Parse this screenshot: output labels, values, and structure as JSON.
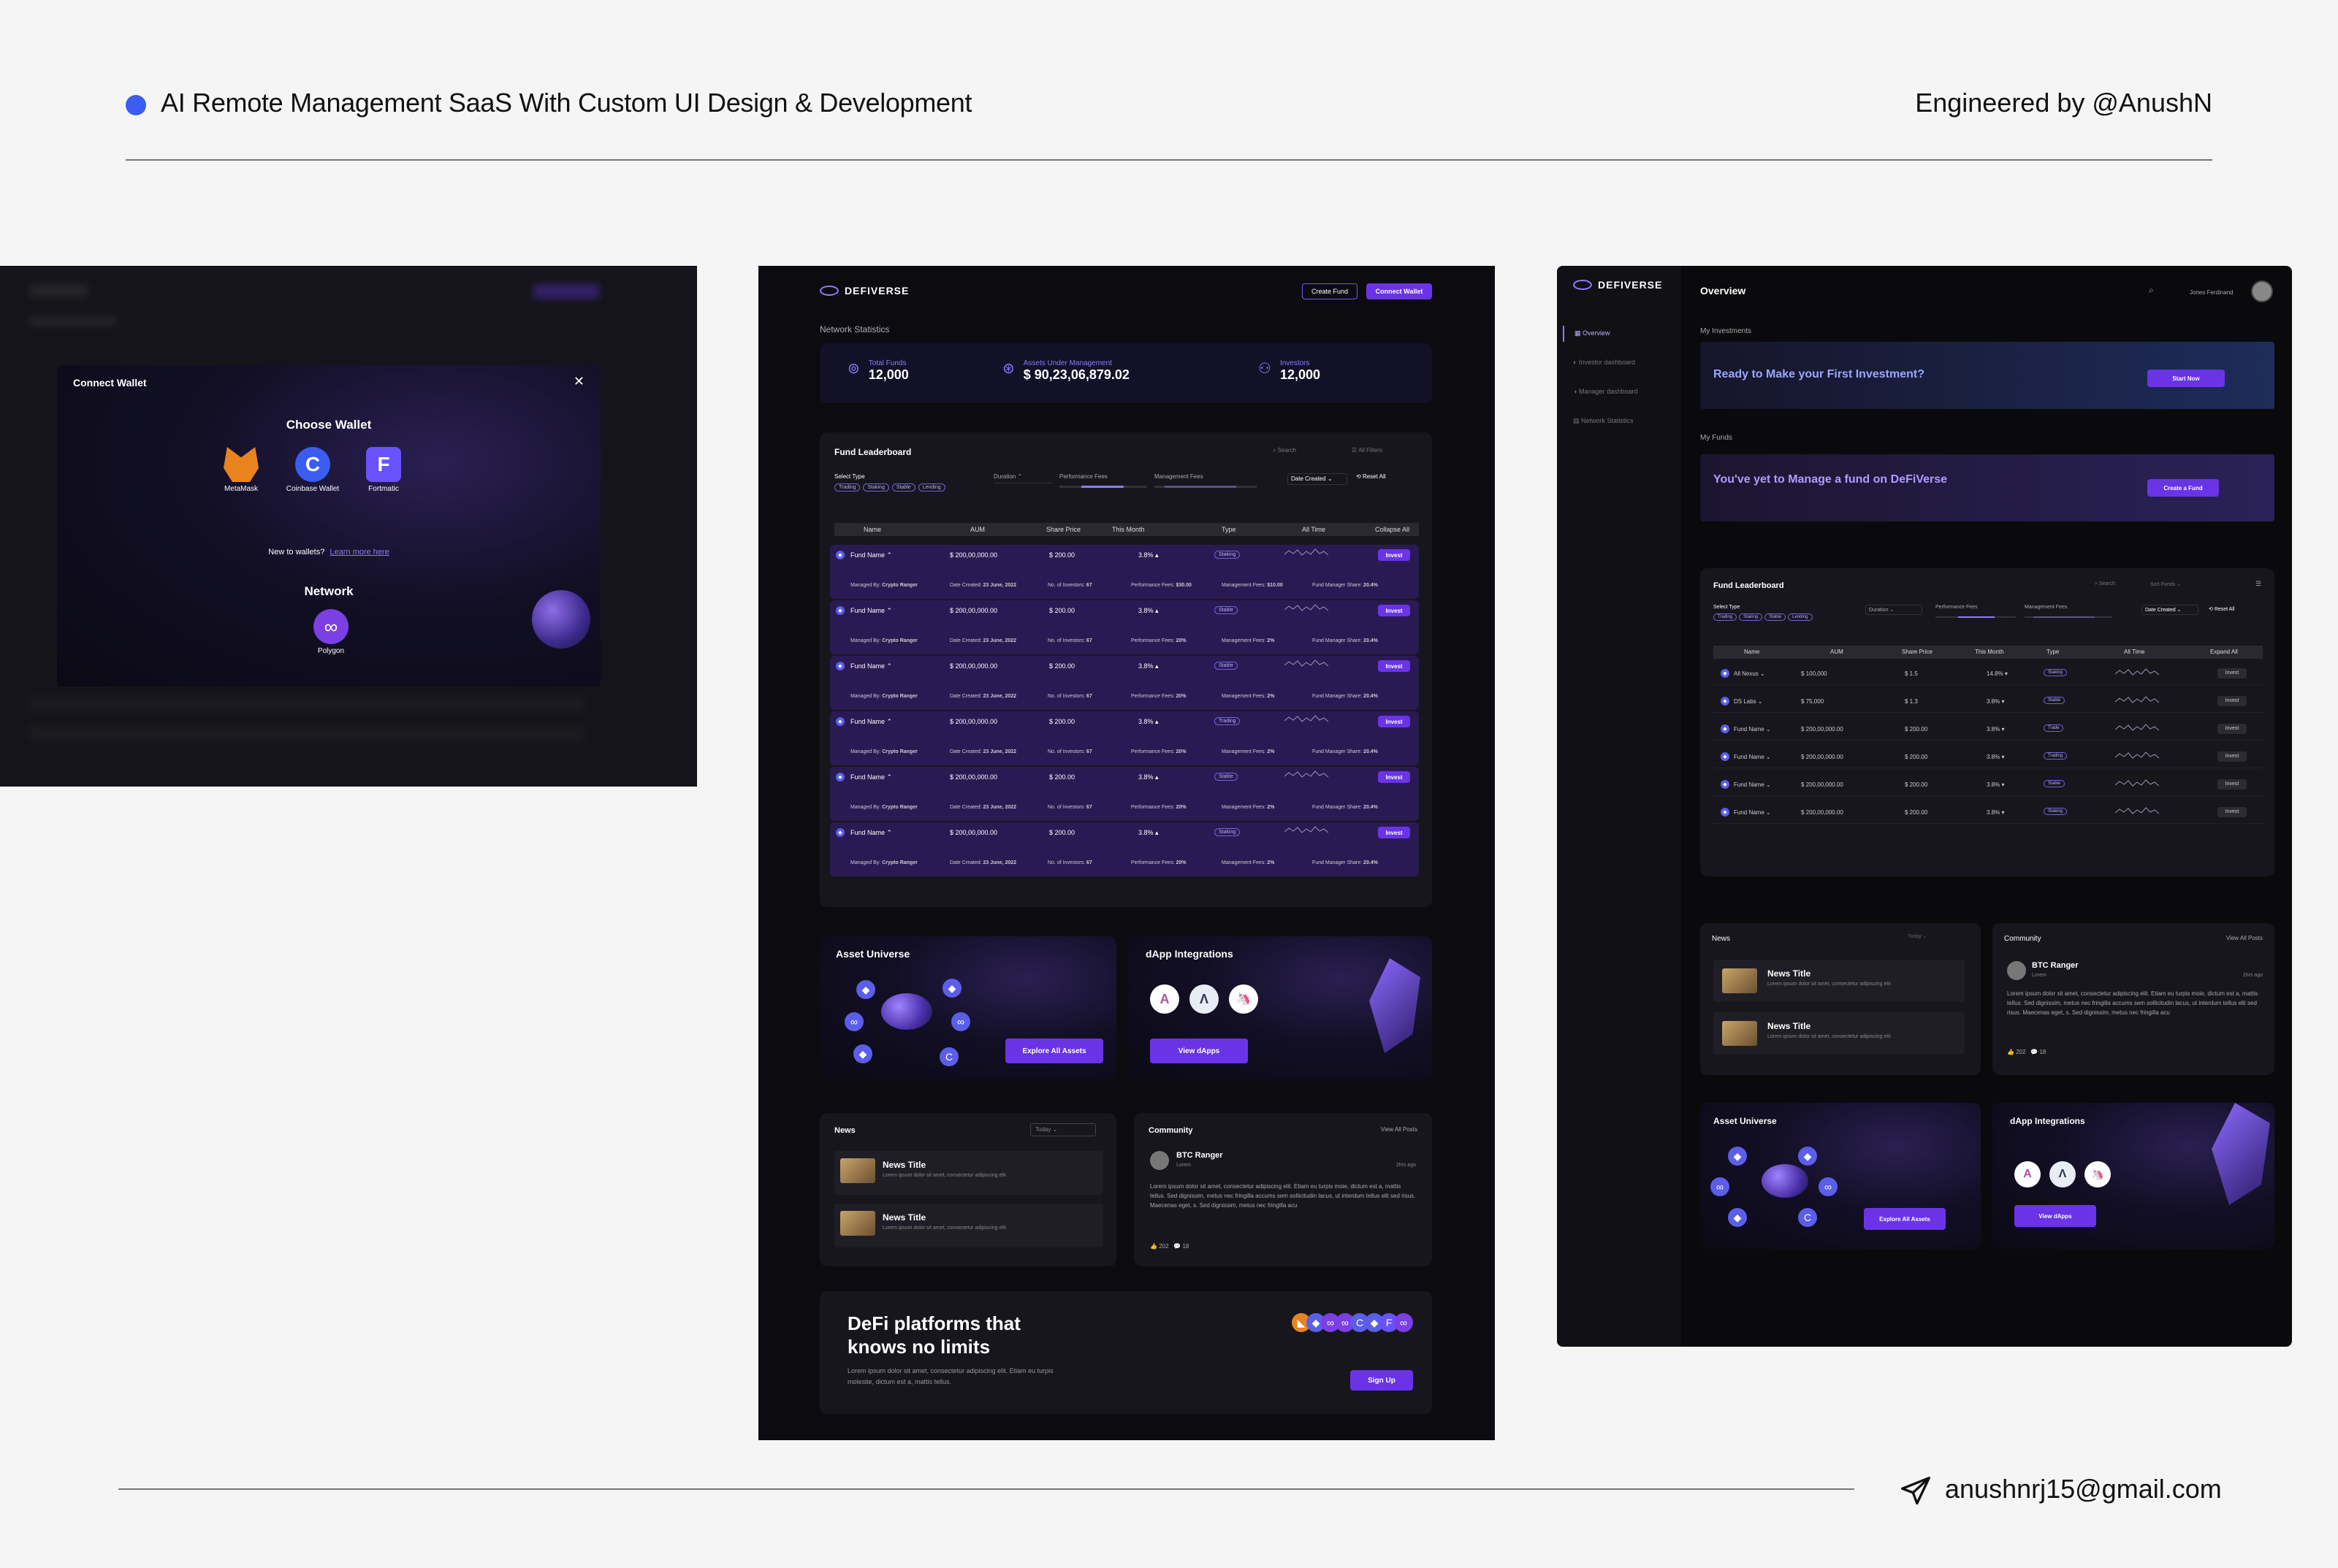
{
  "header": {
    "title": "AI Remote Management SaaS With Custom UI Design & Development",
    "credit": "Engineered by @AnushN"
  },
  "footer": {
    "email": "anushnrj15@gmail.com"
  },
  "colors": {
    "accent": "#6a34e6",
    "brand_blue": "#3b5cf0",
    "panel_bg": "#0c0b10",
    "row_highlight": "#2a1a54"
  },
  "wallet": {
    "title": "Connect Wallet",
    "choose": "Choose Wallet",
    "wallets": [
      "MetaMask",
      "Coinbase Wallet",
      "Fortmatic"
    ],
    "new_text": "New to wallets?",
    "learn_link": "Learn more here",
    "network_title": "Network",
    "network": "Polygon"
  },
  "defi": {
    "logo": "DEFIVERSE",
    "create_fund": "Create Fund",
    "connect_wallet": "Connect Wallet",
    "net_title": "Network Statistics",
    "stats": [
      {
        "label": "Total Funds",
        "value": "12,000"
      },
      {
        "label": "Assets Under Management",
        "value": "$ 90,23,06,879.02"
      },
      {
        "label": "Investors",
        "value": "12,000"
      }
    ],
    "leaderboard": {
      "title": "Fund Leaderboard",
      "search": "Search",
      "all_filters": "All Filters",
      "select_type": "Select Type",
      "types": [
        "Trading",
        "Staking",
        "Stable",
        "Lending"
      ],
      "duration": "Duration",
      "perf_fees": "Performance Fees",
      "mgmt_fees": "Management Fees",
      "date_created": "Date Created",
      "reset": "Reset All",
      "collapse": "Collapse All",
      "columns": [
        "Name",
        "AUM",
        "Share Price",
        "This Month",
        "Type",
        "All Time"
      ],
      "rows": [
        {
          "name": "Fund Name",
          "aum": "$ 200,00,000.00",
          "price": "$ 200.00",
          "month": "3.8%",
          "type": "Staking",
          "action": "Invest",
          "manager": "Crypto Ranger",
          "date": "23 June, 2022",
          "investors": "67",
          "perf": "$30.00",
          "mgmt": "$10.00",
          "share": "20.4%"
        },
        {
          "name": "Fund Name",
          "aum": "$ 200,00,000.00",
          "price": "$ 200.00",
          "month": "3.8%",
          "type": "Stable",
          "action": "Invest",
          "manager": "Crypto Ranger",
          "date": "23 June, 2022",
          "investors": "67",
          "perf": "20%",
          "mgmt": "2%",
          "share": "20.4%"
        },
        {
          "name": "Fund Name",
          "aum": "$ 200,00,000.00",
          "price": "$ 200.00",
          "month": "3.8%",
          "type": "Stable",
          "action": "Invest",
          "manager": "Crypto Ranger",
          "date": "23 June, 2022",
          "investors": "67",
          "perf": "20%",
          "mgmt": "2%",
          "share": "20.4%"
        },
        {
          "name": "Fund Name",
          "aum": "$ 200,00,000.00",
          "price": "$ 200.00",
          "month": "3.8%",
          "type": "Trading",
          "action": "Invest",
          "manager": "Crypto Ranger",
          "date": "23 June, 2022",
          "investors": "67",
          "perf": "20%",
          "mgmt": "2%",
          "share": "20.4%"
        },
        {
          "name": "Fund Name",
          "aum": "$ 200,00,000.00",
          "price": "$ 200.00",
          "month": "3.8%",
          "type": "Stable",
          "action": "Invest",
          "manager": "Crypto Ranger",
          "date": "23 June, 2022",
          "investors": "67",
          "perf": "20%",
          "mgmt": "2%",
          "share": "20.4%"
        },
        {
          "name": "Fund Name",
          "aum": "$ 200,00,000.00",
          "price": "$ 200.00",
          "month": "3.8%",
          "type": "Staking",
          "action": "Invest",
          "manager": "Crypto Ranger",
          "date": "23 June, 2022",
          "investors": "67",
          "perf": "20%",
          "mgmt": "2%",
          "share": "20.4%"
        }
      ],
      "labels": {
        "managed_by": "Managed By:",
        "date_created": "Date Created:",
        "investors": "No. of Investors:",
        "perf": "Performance Fees:",
        "mgmt": "Management Fees:",
        "share": "Fund Manager Share:"
      }
    },
    "asset_universe": {
      "title": "Asset Universe",
      "button": "Explore All Assets"
    },
    "dapp": {
      "title": "dApp Integrations",
      "button": "View dApps"
    },
    "news": {
      "title": "News",
      "filter": "Today",
      "items": [
        {
          "title": "News Title",
          "body": "Lorem ipsum dolor sit amet, consectetur adipiscing elit."
        },
        {
          "title": "News Title",
          "body": "Lorem ipsum dolor sit amet, consectetur adipiscing elit."
        }
      ]
    },
    "community": {
      "title": "Community",
      "view_all": "View All Posts",
      "user": "BTC Ranger",
      "role": "Lorem",
      "time": "2hrs ago",
      "body": "Lorem ipsum dolor sit amet, consectetur adipiscing elit. Etiam eu turpis moie, dictum est a, mattis tellus. Sed dignissim, metus nec fringilla accums sem sollicitudin lacus, ut interdum tellus elit sed risus. Maecenas eget, s. Sed dignissim, metus nec fringilla acu",
      "likes": "202",
      "comments": "18"
    },
    "cta": {
      "title1": "DeFi platforms that",
      "title2": "knows no limits",
      "body": "Lorem ipsum dolor sit amet, consectetur adipiscing elit. Etiam eu turpis molestie, dictum est a, mattis tellus.",
      "button": "Sign Up"
    }
  },
  "dash": {
    "logo": "DEFIVERSE",
    "page": "Overview",
    "user": "Jones Ferdinand",
    "nav": [
      "Overview",
      "Investor dashboard",
      "Manager dashboard",
      "Network Statistics"
    ],
    "investments_title": "My Investments",
    "investments_cta": "Ready to Make your First Investment?",
    "start_now": "Start Now",
    "funds_title": "My Funds",
    "funds_cta": "You've yet to Manage a fund on DeFiVerse",
    "create_fund": "Create a Fund",
    "leaderboard": {
      "title": "Fund Leaderboard",
      "search": "Search",
      "sort": "Sort Funds",
      "select_type": "Select Type",
      "types": [
        "Trading",
        "Staking",
        "Stable",
        "Lending"
      ],
      "duration": "Duration",
      "perf_fees": "Performance Fees",
      "mgmt_fees": "Management Fees",
      "date_created": "Date Created",
      "reset": "Reset All",
      "expand": "Expand All",
      "columns": [
        "Name",
        "AUM",
        "Share Price",
        "This Month",
        "Type",
        "All Time"
      ],
      "rows": [
        {
          "name": "All Nexus",
          "aum": "$ 100,000",
          "price": "$ 1.5",
          "month": "14.8%",
          "type": "Staking",
          "action": "Invest"
        },
        {
          "name": "DS Labs",
          "aum": "$ 75,000",
          "price": "$ 1.3",
          "month": "3.8%",
          "type": "Stable",
          "action": "Invest"
        },
        {
          "name": "Fund Name",
          "aum": "$ 200,00,000.00",
          "price": "$ 200.00",
          "month": "3.8%",
          "type": "Trade",
          "action": "Invest"
        },
        {
          "name": "Fund Name",
          "aum": "$ 200,00,000.00",
          "price": "$ 200.00",
          "month": "3.8%",
          "type": "Trading",
          "action": "Invest"
        },
        {
          "name": "Fund Name",
          "aum": "$ 200,00,000.00",
          "price": "$ 200.00",
          "month": "3.8%",
          "type": "Stable",
          "action": "Invest"
        },
        {
          "name": "Fund Name",
          "aum": "$ 200,00,000.00",
          "price": "$ 200.00",
          "month": "3.8%",
          "type": "Staking",
          "action": "Invest"
        }
      ]
    },
    "news": {
      "title": "News",
      "filter": "Today",
      "items": [
        {
          "title": "News Title",
          "body": "Lorem ipsum dolor sit amet, consectetur adipiscing elit."
        },
        {
          "title": "News Title",
          "body": "Lorem ipsum dolor sit amet, consectetur adipiscing elit."
        }
      ]
    },
    "community": {
      "title": "Community",
      "view_all": "View All Posts",
      "user": "BTC Ranger",
      "role": "Lorem",
      "time": "2hrs ago",
      "body": "Lorem ipsum dolor sit amet, consectetur adipiscing elit. Etiam eu turpis moie, dictum est a, mattis tellus. Sed dignissim, metus nec fringilla accums sem sollicitudin lacus, ut interdum tellus elit sed risus. Maecenas eget, s. Sed dignissim, metus nec fringilla acu",
      "likes": "202",
      "comments": "18"
    },
    "asset_universe": {
      "title": "Asset Universe",
      "button": "Explore All Assets"
    },
    "dapp": {
      "title": "dApp Integrations",
      "button": "View dApps"
    }
  }
}
